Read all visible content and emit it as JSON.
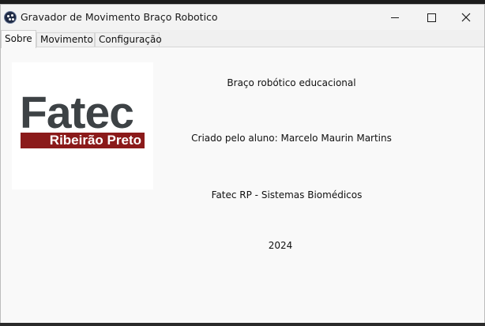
{
  "window": {
    "title": "Gravador de Movimento Braço Robotico",
    "controls": [
      "minimize-icon",
      "maximize-icon",
      "close-icon"
    ]
  },
  "tabs": [
    {
      "label": "Sobre",
      "active": true
    },
    {
      "label": "Movimento",
      "active": false
    },
    {
      "label": "Configuração",
      "active": false
    }
  ],
  "about": {
    "logo": {
      "main": "Fatec",
      "sub": "Ribeirão Preto"
    },
    "lines": [
      "Braço robótico educacional",
      "Criado pelo aluno: Marcelo Maurin Martins",
      "Fatec RP - Sistemas Biomédicos",
      "2024"
    ]
  },
  "colors": {
    "logo_text": "#3d4245",
    "logo_band": "#8b1a1a",
    "panel_bg": "#f9f9f9"
  }
}
